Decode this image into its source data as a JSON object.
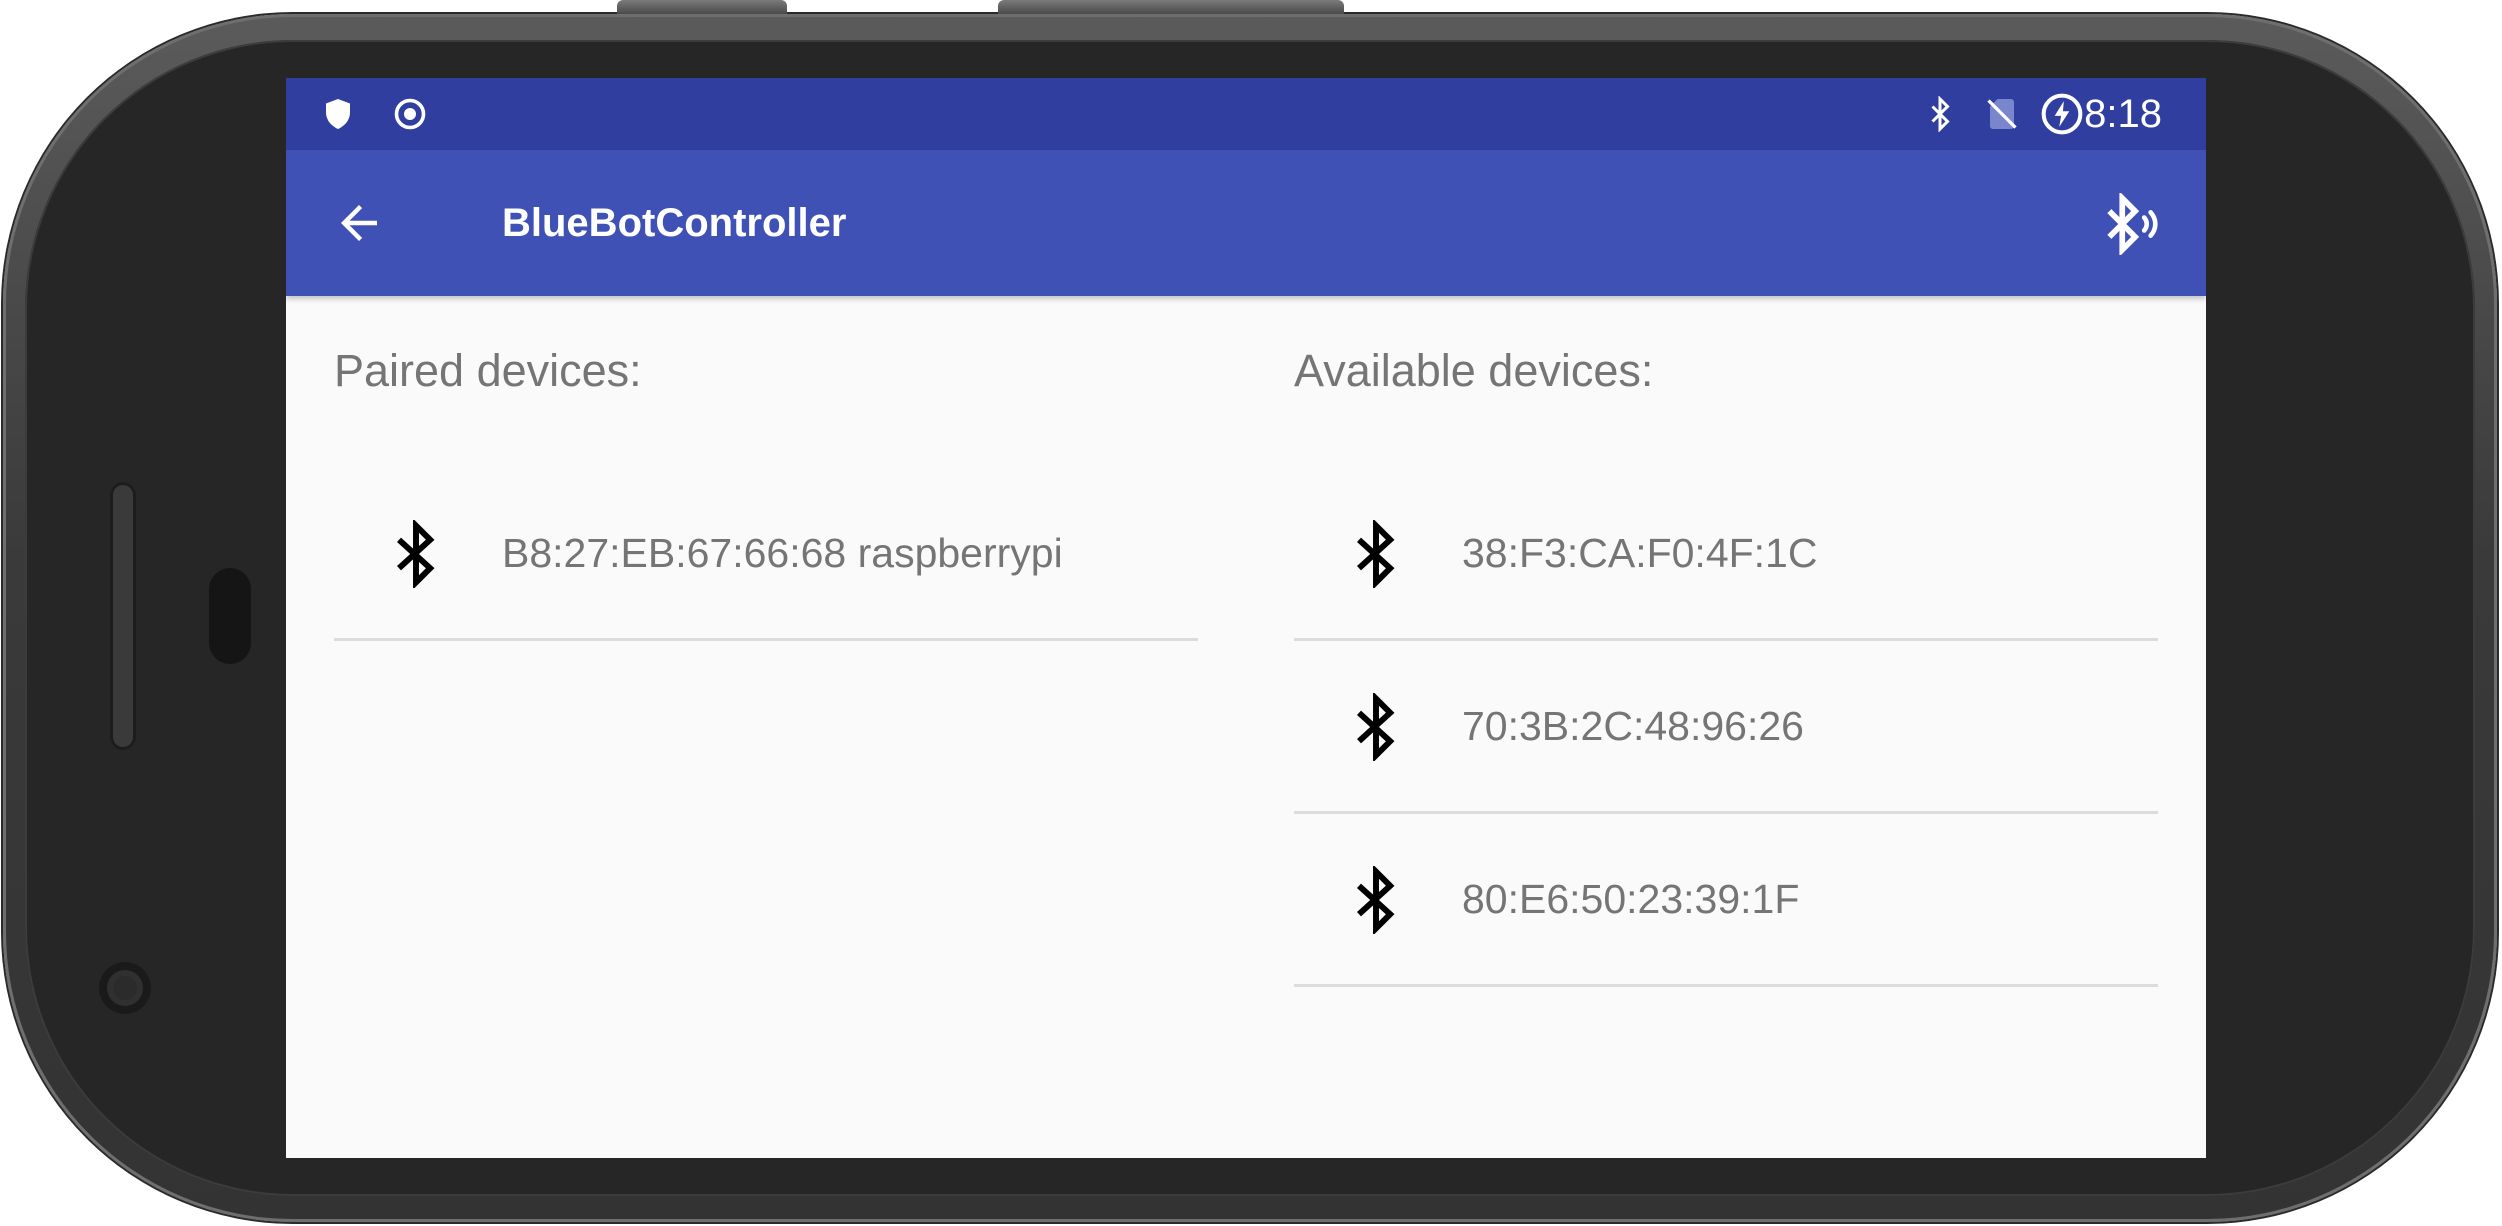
{
  "status_bar": {
    "time": "8:18",
    "left_icons": [
      "shield-icon",
      "target-icon"
    ],
    "right_icons": [
      "bluetooth-icon",
      "no-sim-icon",
      "battery-saver-icon"
    ],
    "background": "#303f9f"
  },
  "app_bar": {
    "title": "BlueBotController",
    "background": "#3f51b5",
    "back_icon": "arrow-back-icon",
    "action_icon": "bluetooth-searching-icon"
  },
  "paired": {
    "header": "Paired devices:",
    "devices": [
      {
        "name": "B8:27:EB:67:66:68 raspberrypi",
        "icon": "bluetooth-icon"
      }
    ]
  },
  "available": {
    "header": "Available devices:",
    "devices": [
      {
        "name": "38:F3:CA:F0:4F:1C",
        "icon": "bluetooth-icon"
      },
      {
        "name": "70:3B:2C:48:96:26",
        "icon": "bluetooth-icon"
      },
      {
        "name": "80:E6:50:23:39:1F",
        "icon": "bluetooth-icon"
      }
    ]
  }
}
